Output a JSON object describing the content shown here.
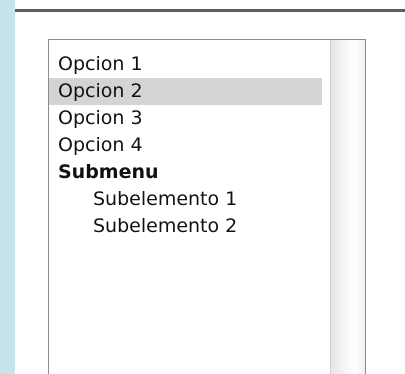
{
  "listbox": {
    "items": [
      {
        "label": "Opcion 1",
        "type": "option",
        "selected": false
      },
      {
        "label": "Opcion 2",
        "type": "option",
        "selected": true
      },
      {
        "label": "Opcion 3",
        "type": "option",
        "selected": false
      },
      {
        "label": "Opcion 4",
        "type": "option",
        "selected": false
      },
      {
        "label": "Submenu",
        "type": "group-header",
        "selected": false
      },
      {
        "label": "Subelemento 1",
        "type": "sub-option",
        "selected": false
      },
      {
        "label": "Subelemento 2",
        "type": "sub-option",
        "selected": false
      }
    ]
  },
  "colors": {
    "background": "#c6e4ea",
    "selected_row": "#d4d4d4"
  }
}
